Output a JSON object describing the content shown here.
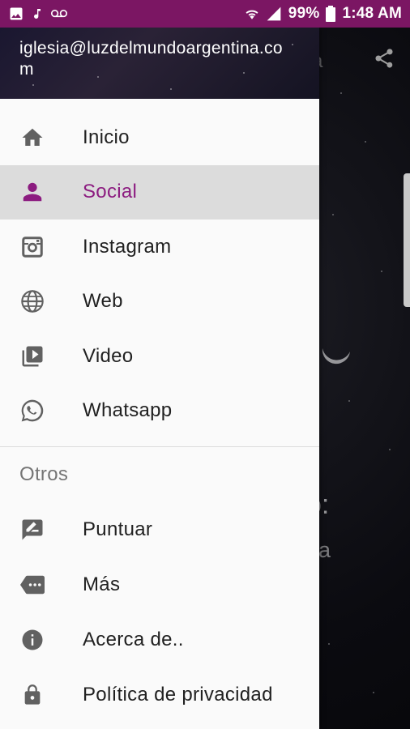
{
  "status_bar": {
    "battery": "99%",
    "time": "1:48 AM",
    "left_icons": [
      "image-icon",
      "music-note-icon",
      "voicemail-icon"
    ],
    "right_icons": [
      "wifi-icon",
      "signal-icon",
      "battery-icon"
    ]
  },
  "drawer": {
    "email": "iglesia@luzdelmundoargentina.com",
    "items": [
      {
        "label": "Inicio",
        "icon": "home-icon",
        "active": false
      },
      {
        "label": "Social",
        "icon": "person-icon",
        "active": true
      },
      {
        "label": "Instagram",
        "icon": "instagram-icon",
        "active": false
      },
      {
        "label": "Web",
        "icon": "globe-icon",
        "active": false
      },
      {
        "label": "Video",
        "icon": "video-library-icon",
        "active": false
      },
      {
        "label": "Whatsapp",
        "icon": "whatsapp-icon",
        "active": false
      }
    ],
    "section_title": "Otros",
    "other_items": [
      {
        "label": "Puntuar",
        "icon": "rate-review-icon"
      },
      {
        "label": "Más",
        "icon": "more-icon"
      },
      {
        "label": "Acerca de..",
        "icon": "info-icon"
      },
      {
        "label": "Política de privacidad",
        "icon": "lock-icon"
      }
    ]
  },
  "background": {
    "title_fragment": "a",
    "heading_fragment": "o:",
    "subtitle_fragment": "na"
  },
  "colors": {
    "status_bar": "#7b1663",
    "accent": "#8c1c80",
    "icon_grey": "#616161"
  }
}
